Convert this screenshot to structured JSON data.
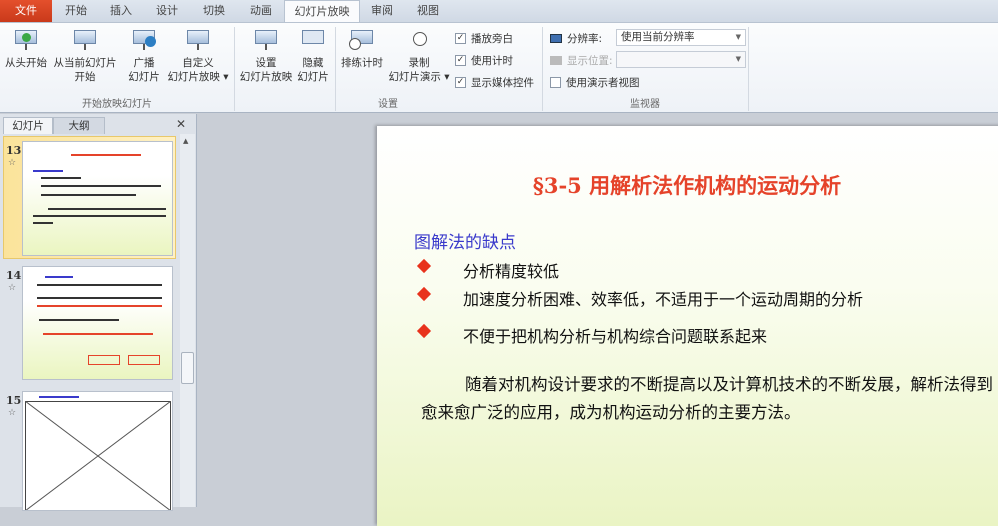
{
  "tabs": [
    "文件",
    "开始",
    "插入",
    "设计",
    "切换",
    "动画",
    "幻灯片放映",
    "审阅",
    "视图"
  ],
  "ribbon": {
    "group1": {
      "label": "开始放映幻灯片",
      "buttons": [
        "从头开始",
        "从当前幻灯片\n开始",
        "广播\n幻灯片",
        "自定义\n幻灯片放映 ▾"
      ]
    },
    "group2": {
      "label": "设置",
      "buttons": [
        "设置\n幻灯片放映",
        "隐藏\n幻灯片",
        "排练计时",
        "录制\n幻灯片演示 ▾"
      ],
      "checks": [
        {
          "label": "播放旁白",
          "checked": true
        },
        {
          "label": "使用计时",
          "checked": true
        },
        {
          "label": "显示媒体控件",
          "checked": true
        }
      ]
    },
    "group3": {
      "label": "监视器",
      "resolution_label": "分辨率:",
      "resolution_value": "使用当前分辨率",
      "show_on_label": "显示位置:",
      "show_on_value": "",
      "presenter_view": {
        "label": "使用演示者视图",
        "checked": false
      }
    }
  },
  "panel": {
    "tabs": [
      "幻灯片",
      "大纲"
    ],
    "close": "✕",
    "slides": [
      {
        "num": "13",
        "star": "☆"
      },
      {
        "num": "14",
        "star": "☆"
      },
      {
        "num": "15",
        "star": "☆"
      }
    ]
  },
  "slide": {
    "title": "§3-5  用解析法作机构的运动分析",
    "subtitle": "图解法的缺点",
    "bullets": [
      "分析精度较低",
      "加速度分析困难、效率低，不适用于一个运动周期的分析",
      "不便于把机构分析与机构综合问题联系起来"
    ],
    "paragraph": "随着对机构设计要求的不断提高以及计算机技术的不断发展，解析法得到愈来愈广泛的应用，成为机构运动分析的主要方法。"
  },
  "colors": {
    "file_tab": "#d8431f",
    "title": "#e5432a",
    "subtitle": "#3a3acb",
    "bullet": "#e8321c"
  }
}
